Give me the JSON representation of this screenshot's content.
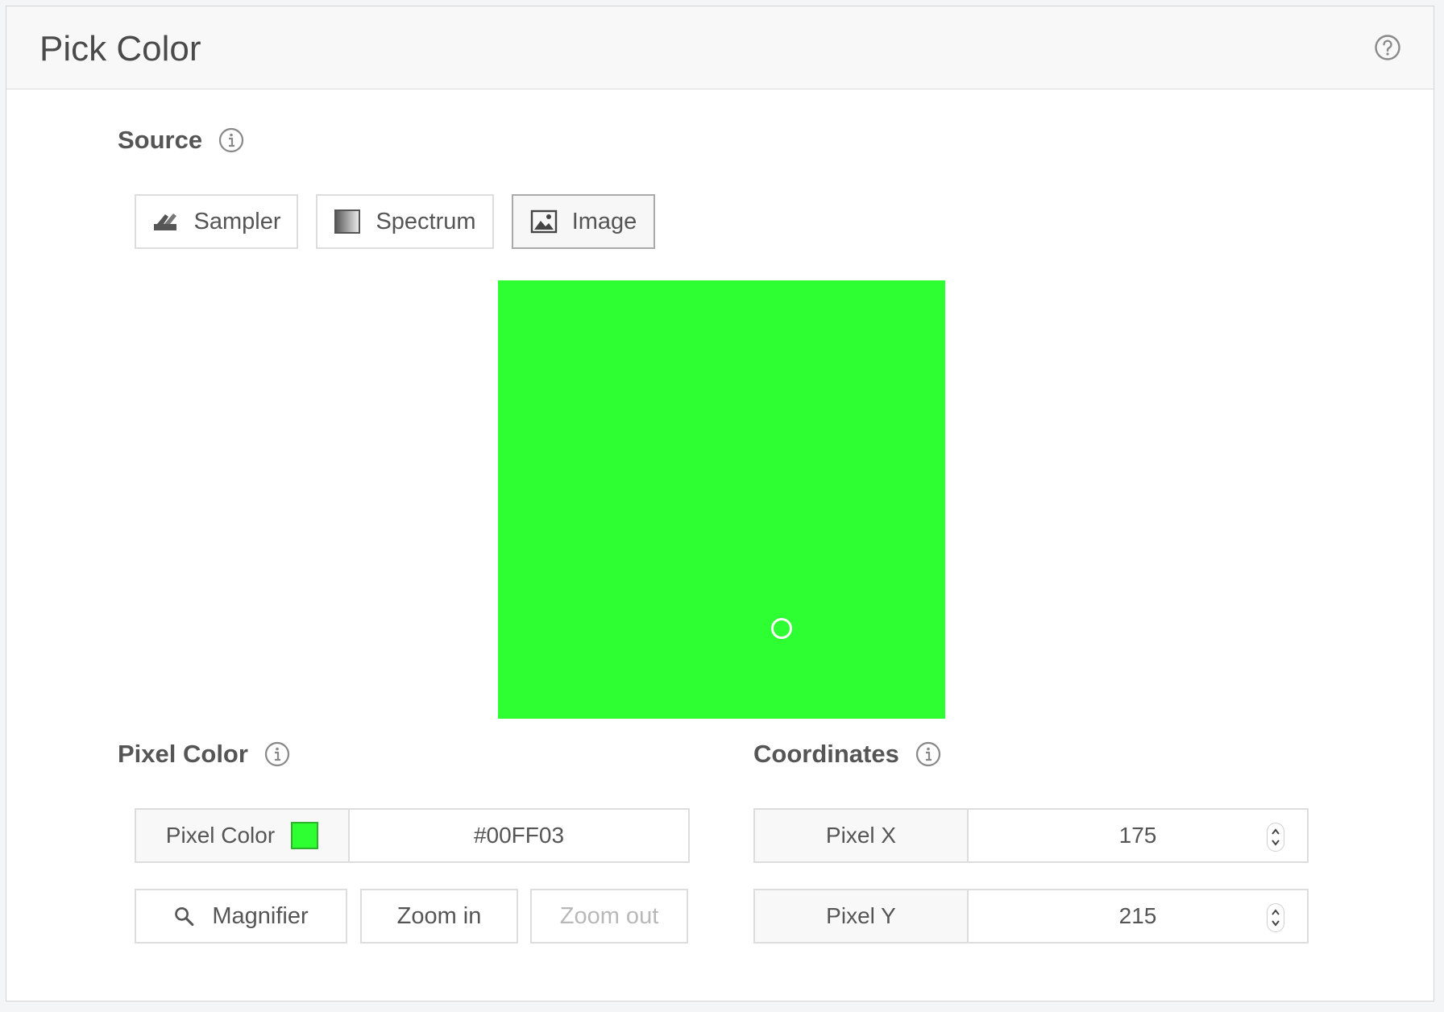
{
  "header": {
    "title": "Pick Color",
    "help_icon": "question-circle-icon"
  },
  "source": {
    "title": "Source",
    "info_icon": "info-circle-icon",
    "tabs": [
      {
        "label": "Sampler",
        "icon": "sampler-icon",
        "active": false
      },
      {
        "label": "Spectrum",
        "icon": "spectrum-icon",
        "active": false
      },
      {
        "label": "Image",
        "icon": "image-icon",
        "active": true
      }
    ]
  },
  "image_canvas": {
    "fill_color": "#2EFF32",
    "cursor_color": "#FFFFFF"
  },
  "pixel_color": {
    "title": "Pixel Color",
    "field_label": "Pixel Color",
    "swatch_color": "#2EFF32",
    "value": "#00FF03",
    "magnifier_label": "Magnifier",
    "zoom_in_label": "Zoom in",
    "zoom_out_label": "Zoom out"
  },
  "coordinates": {
    "title": "Coordinates",
    "x_label": "Pixel X",
    "x_value": "175",
    "y_label": "Pixel Y",
    "y_value": "215"
  }
}
